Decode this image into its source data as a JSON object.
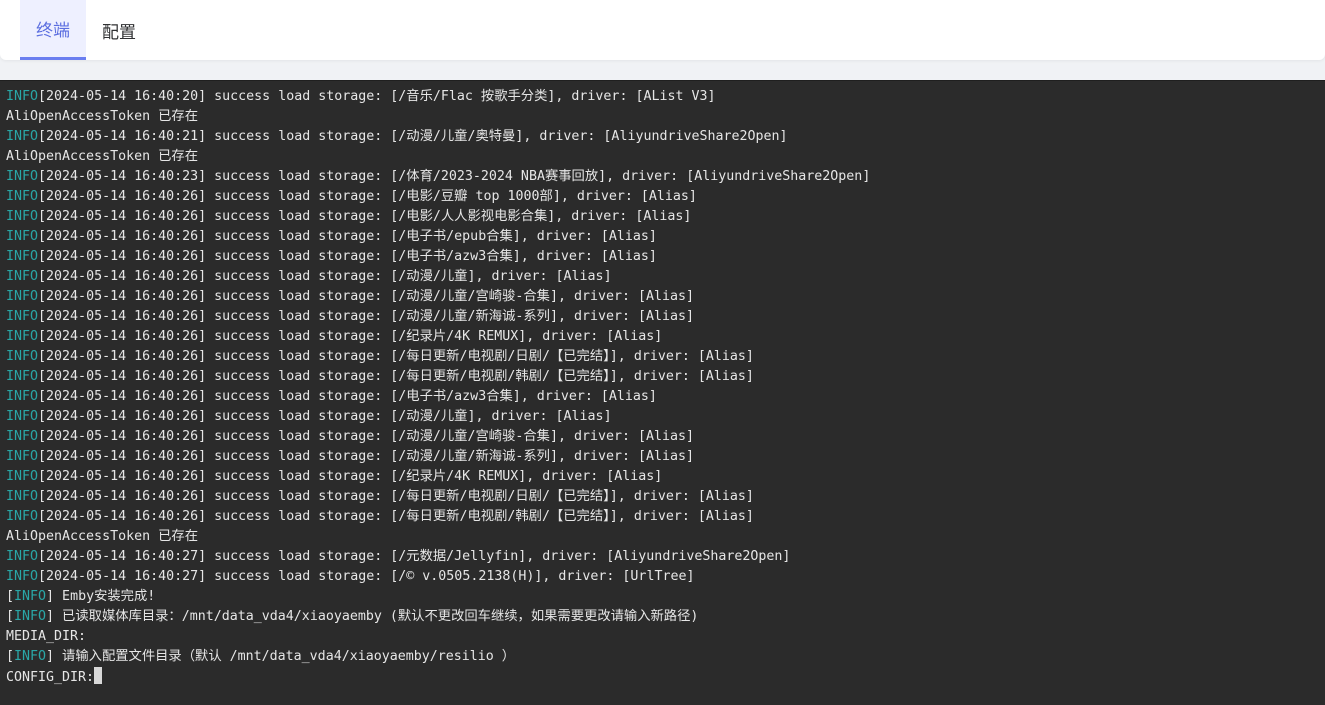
{
  "tabs": [
    {
      "label": "终端",
      "active": true
    },
    {
      "label": "配置",
      "active": false
    }
  ],
  "colors": {
    "tab_active_text": "#5b6ee0",
    "tab_active_underline": "#6a7ef0",
    "terminal_bg": "#2b2b2b",
    "log_level": "#2aa7a7",
    "terminal_text": "#e6e6e6"
  },
  "terminal": {
    "lines": [
      {
        "kind": "log",
        "prefix": "",
        "level": "INFO",
        "text": "[2024-05-14 16:40:20] success load storage: [/音乐/Flac 按歌手分类], driver: [AList V3]"
      },
      {
        "kind": "plain",
        "text": "AliOpenAccessToken 已存在"
      },
      {
        "kind": "log",
        "prefix": "",
        "level": "INFO",
        "text": "[2024-05-14 16:40:21] success load storage: [/动漫/儿童/奥特曼], driver: [AliyundriveShare2Open]"
      },
      {
        "kind": "plain",
        "text": "AliOpenAccessToken 已存在"
      },
      {
        "kind": "log",
        "prefix": "",
        "level": "INFO",
        "text": "[2024-05-14 16:40:23] success load storage: [/体育/2023-2024 NBA赛事回放], driver: [AliyundriveShare2Open]"
      },
      {
        "kind": "log",
        "prefix": "",
        "level": "INFO",
        "text": "[2024-05-14 16:40:26] success load storage: [/电影/豆瓣 top 1000部], driver: [Alias]"
      },
      {
        "kind": "log",
        "prefix": "",
        "level": "INFO",
        "text": "[2024-05-14 16:40:26] success load storage: [/电影/人人影视电影合集], driver: [Alias]"
      },
      {
        "kind": "log",
        "prefix": "",
        "level": "INFO",
        "text": "[2024-05-14 16:40:26] success load storage: [/电子书/epub合集], driver: [Alias]"
      },
      {
        "kind": "log",
        "prefix": "",
        "level": "INFO",
        "text": "[2024-05-14 16:40:26] success load storage: [/电子书/azw3合集], driver: [Alias]"
      },
      {
        "kind": "log",
        "prefix": "",
        "level": "INFO",
        "text": "[2024-05-14 16:40:26] success load storage: [/动漫/儿童], driver: [Alias]"
      },
      {
        "kind": "log",
        "prefix": "",
        "level": "INFO",
        "text": "[2024-05-14 16:40:26] success load storage: [/动漫/儿童/宫崎骏-合集], driver: [Alias]"
      },
      {
        "kind": "log",
        "prefix": "",
        "level": "INFO",
        "text": "[2024-05-14 16:40:26] success load storage: [/动漫/儿童/新海诚-系列], driver: [Alias]"
      },
      {
        "kind": "log",
        "prefix": "",
        "level": "INFO",
        "text": "[2024-05-14 16:40:26] success load storage: [/纪录片/4K REMUX], driver: [Alias]"
      },
      {
        "kind": "log",
        "prefix": "",
        "level": "INFO",
        "text": "[2024-05-14 16:40:26] success load storage: [/每日更新/电视剧/日剧/【已完结】], driver: [Alias]"
      },
      {
        "kind": "log",
        "prefix": "",
        "level": "INFO",
        "text": "[2024-05-14 16:40:26] success load storage: [/每日更新/电视剧/韩剧/【已完结】], driver: [Alias]"
      },
      {
        "kind": "log",
        "prefix": "",
        "level": "INFO",
        "text": "[2024-05-14 16:40:26] success load storage: [/电子书/azw3合集], driver: [Alias]"
      },
      {
        "kind": "log",
        "prefix": "",
        "level": "INFO",
        "text": "[2024-05-14 16:40:26] success load storage: [/动漫/儿童], driver: [Alias]"
      },
      {
        "kind": "log",
        "prefix": "",
        "level": "INFO",
        "text": "[2024-05-14 16:40:26] success load storage: [/动漫/儿童/宫崎骏-合集], driver: [Alias]"
      },
      {
        "kind": "log",
        "prefix": "",
        "level": "INFO",
        "text": "[2024-05-14 16:40:26] success load storage: [/动漫/儿童/新海诚-系列], driver: [Alias]"
      },
      {
        "kind": "log",
        "prefix": "",
        "level": "INFO",
        "text": "[2024-05-14 16:40:26] success load storage: [/纪录片/4K REMUX], driver: [Alias]"
      },
      {
        "kind": "log",
        "prefix": "",
        "level": "INFO",
        "text": "[2024-05-14 16:40:26] success load storage: [/每日更新/电视剧/日剧/【已完结】], driver: [Alias]"
      },
      {
        "kind": "log",
        "prefix": "",
        "level": "INFO",
        "text": "[2024-05-14 16:40:26] success load storage: [/每日更新/电视剧/韩剧/【已完结】], driver: [Alias]"
      },
      {
        "kind": "plain",
        "text": "AliOpenAccessToken 已存在"
      },
      {
        "kind": "log",
        "prefix": "",
        "level": "INFO",
        "text": "[2024-05-14 16:40:27] success load storage: [/元数据/Jellyfin], driver: [AliyundriveShare2Open]"
      },
      {
        "kind": "log",
        "prefix": "",
        "level": "INFO",
        "text": "[2024-05-14 16:40:27] success load storage: [/© v.0505.2138(H)], driver: [UrlTree]"
      },
      {
        "kind": "log",
        "prefix": "[",
        "level": "INFO",
        "text": "] Emby安装完成!"
      },
      {
        "kind": "log",
        "prefix": "[",
        "level": "INFO",
        "text": "] 已读取媒体库目录：/mnt/data_vda4/xiaoyaemby (默认不更改回车继续，如果需要更改请输入新路径)"
      },
      {
        "kind": "plain",
        "text": "MEDIA_DIR:"
      },
      {
        "kind": "log",
        "prefix": "[",
        "level": "INFO",
        "text": "] 请输入配置文件目录（默认 /mnt/data_vda4/xiaoyaemby/resilio ）"
      },
      {
        "kind": "prompt",
        "text": "CONFIG_DIR:"
      }
    ]
  }
}
